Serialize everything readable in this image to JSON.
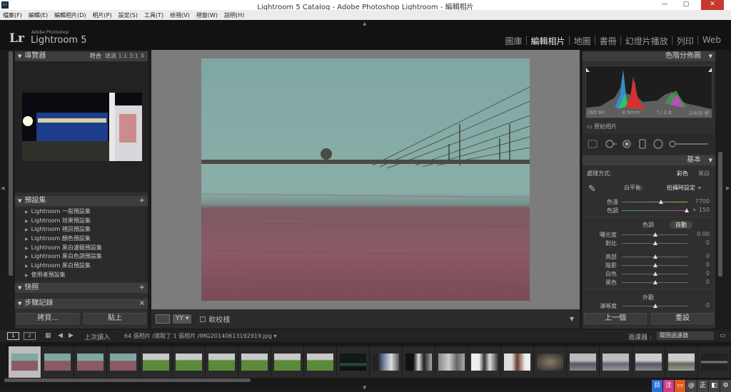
{
  "window": {
    "title": "Lightroom 5 Catalog - Adobe Photoshop Lightroom - 編輯相片",
    "lr_badge": "Lr",
    "min": "—",
    "max": "▢",
    "close": "✕"
  },
  "menu": [
    "檔案(F)",
    "編輯(E)",
    "編輯相片(D)",
    "相片(P)",
    "設定(S)",
    "工具(T)",
    "檢視(V)",
    "視窗(W)",
    "說明(H)"
  ],
  "identity": {
    "lr": "Lr",
    "adobe": "Adobe Photoshop",
    "product": "Lightroom 5"
  },
  "modules": [
    "圖庫",
    "編輯相片",
    "地圖",
    "書冊",
    "幻燈片播放",
    "列印",
    "Web"
  ],
  "active_module": "編輯相片",
  "navigator": {
    "title": "導覽器",
    "options": [
      "符合",
      "填滿",
      "1:1",
      "3:1"
    ]
  },
  "presets": {
    "title": "預設集",
    "items": [
      "Lightroom 一般預設集",
      "Lightroom 效果預設集",
      "Lightroom 視訊預設集",
      "Lightroom 顏色預設集",
      "Lightroom 黑白濾鏡預設集",
      "Lightroom 黑白色調預設集",
      "Lightroom 黑白預設集",
      "使用者預設集"
    ]
  },
  "snapshots": {
    "title": "快照"
  },
  "history": {
    "title": "步驟記錄",
    "close": "×"
  },
  "left_buttons": {
    "copy": "拷貝...",
    "paste": "貼上"
  },
  "toolbar": {
    "soft_proof": "軟校樣"
  },
  "histogram": {
    "title": "色階分佈圖",
    "iso": "ISO 80",
    "focal": "8.9mm",
    "aperture": "f / 2.8",
    "shutter": "1/400 秒",
    "original": "原始相片"
  },
  "basic": {
    "title": "基本",
    "treatment_label": "處理方式:",
    "treatment_color": "彩色",
    "treatment_bw": "黑白",
    "wb_label": "白平衡:",
    "wb_value": "拍攝時設定 ÷",
    "temp": {
      "label": "色溫",
      "value": "7700"
    },
    "tint": {
      "label": "色調",
      "value": "+ 150"
    },
    "tone_label": "色調",
    "auto": "自動",
    "exposure": {
      "label": "曝光度",
      "value": "0.00"
    },
    "contrast": {
      "label": "對比",
      "value": "0"
    },
    "highlights": {
      "label": "亮部",
      "value": "0"
    },
    "shadows": {
      "label": "陰影",
      "value": "0"
    },
    "whites": {
      "label": "白色",
      "value": "0"
    },
    "blacks": {
      "label": "黑色",
      "value": "0"
    },
    "presence_label": "外觀",
    "clarity": {
      "label": "清晰度",
      "value": "0"
    }
  },
  "right_buttons": {
    "previous": "上一個",
    "reset": "重設"
  },
  "filmstrip_bar": {
    "page1": "1",
    "page2": "2",
    "source": "上次讀入",
    "count": "64 張相片 /選取了 1 張相片 /IMG20140613192919.jpg ▾",
    "filter_label": "過濾器 :",
    "filter_value": "關閉過濾器"
  },
  "tray": [
    "目",
    "注",
    "▭",
    "@",
    "正",
    "◧",
    "⚙"
  ],
  "colors": {
    "accent_bg": "#2f2f2f",
    "photo_sky": "#7fa7a2",
    "photo_field": "#8b5a66"
  }
}
